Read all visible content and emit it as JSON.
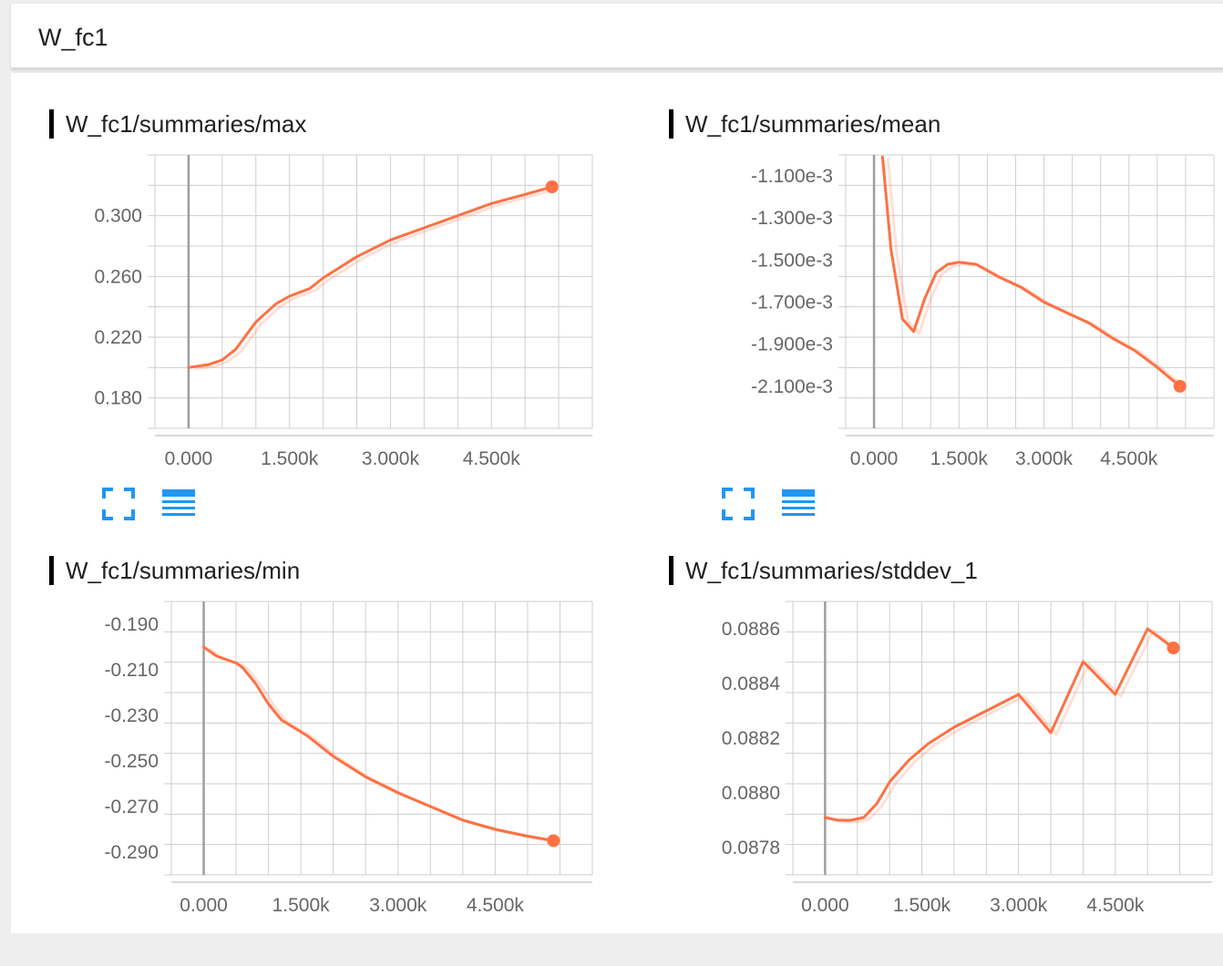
{
  "section": {
    "title": "W_fc1"
  },
  "accent_color": "#ff7043",
  "button_color": "#2196f3",
  "icons": {
    "expand": "fullscreen-icon",
    "data": "list-lines-icon"
  },
  "chart_data": [
    {
      "type": "line",
      "title": "W_fc1/summaries/max",
      "x_ticks": [
        "0.000",
        "1.500k",
        "3.000k",
        "4.500k"
      ],
      "x_tick_values": [
        0,
        1500,
        3000,
        4500
      ],
      "y_ticks": [
        "0.180",
        "0.220",
        "0.260",
        "0.300"
      ],
      "y_tick_values": [
        0.18,
        0.22,
        0.26,
        0.3
      ],
      "xlim": [
        -500,
        6000
      ],
      "ylim": [
        0.16,
        0.34
      ],
      "grid": true,
      "series": [
        {
          "x": [
            0,
            300,
            500,
            700,
            1000,
            1300,
            1500,
            1800,
            2000,
            2500,
            3000,
            3500,
            4000,
            4500,
            5000,
            5400
          ],
          "y": [
            0.2,
            0.202,
            0.205,
            0.212,
            0.23,
            0.242,
            0.247,
            0.252,
            0.259,
            0.273,
            0.284,
            0.292,
            0.3,
            0.308,
            0.314,
            0.319
          ]
        }
      ]
    },
    {
      "type": "line",
      "title": "W_fc1/summaries/mean",
      "x_ticks": [
        "0.000",
        "1.500k",
        "3.000k",
        "4.500k"
      ],
      "x_tick_values": [
        0,
        1500,
        3000,
        4500
      ],
      "y_ticks": [
        "-1.100e-3",
        "-1.300e-3",
        "-1.500e-3",
        "-1.700e-3",
        "-1.900e-3",
        "-2.100e-3"
      ],
      "y_tick_values": [
        -0.0011,
        -0.0013,
        -0.0015,
        -0.0017,
        -0.0019,
        -0.0021
      ],
      "xlim": [
        -500,
        6000
      ],
      "ylim": [
        -0.0023,
        -0.001
      ],
      "grid": true,
      "series": [
        {
          "x": [
            150,
            300,
            500,
            700,
            900,
            1100,
            1300,
            1500,
            1800,
            2200,
            2600,
            3000,
            3400,
            3800,
            4200,
            4600,
            5000,
            5400
          ],
          "y": [
            -0.00101,
            -0.00145,
            -0.00178,
            -0.00184,
            -0.00168,
            -0.00156,
            -0.00152,
            -0.00151,
            -0.00152,
            -0.00158,
            -0.00163,
            -0.0017,
            -0.00175,
            -0.0018,
            -0.00187,
            -0.00193,
            -0.00201,
            -0.0021
          ]
        }
      ]
    },
    {
      "type": "line",
      "title": "W_fc1/summaries/min",
      "x_ticks": [
        "0.000",
        "1.500k",
        "3.000k",
        "4.500k"
      ],
      "x_tick_values": [
        0,
        1500,
        3000,
        4500
      ],
      "y_ticks": [
        "-0.190",
        "-0.210",
        "-0.230",
        "-0.250",
        "-0.270",
        "-0.290"
      ],
      "y_tick_values": [
        -0.19,
        -0.21,
        -0.23,
        -0.25,
        -0.27,
        -0.29
      ],
      "xlim": [
        -500,
        6000
      ],
      "ylim": [
        -0.3,
        -0.18
      ],
      "grid": true,
      "series": [
        {
          "x": [
            0,
            200,
            500,
            600,
            800,
            1000,
            1200,
            1600,
            2000,
            2500,
            3000,
            3500,
            4000,
            4500,
            5000,
            5400
          ],
          "y": [
            -0.2,
            -0.204,
            -0.207,
            -0.209,
            -0.216,
            -0.225,
            -0.232,
            -0.239,
            -0.248,
            -0.257,
            -0.264,
            -0.27,
            -0.276,
            -0.28,
            -0.283,
            -0.285
          ]
        }
      ]
    },
    {
      "type": "line",
      "title": "W_fc1/summaries/stddev_1",
      "x_ticks": [
        "0.000",
        "1.500k",
        "3.000k",
        "4.500k"
      ],
      "x_tick_values": [
        0,
        1500,
        3000,
        4500
      ],
      "y_ticks": [
        "0.0886",
        "0.0884",
        "0.0882",
        "0.0880",
        "0.0878"
      ],
      "y_tick_values": [
        0.0886,
        0.0884,
        0.0882,
        0.088,
        0.0878
      ],
      "xlim": [
        -500,
        6000
      ],
      "ylim": [
        0.0877,
        0.0887
      ],
      "grid": true,
      "series": [
        {
          "x": [
            0,
            200,
            400,
            600,
            800,
            1000,
            1300,
            1600,
            2000,
            2500,
            3000,
            3500,
            4000,
            4500,
            5000,
            5400
          ],
          "y": [
            0.08791,
            0.0879,
            0.0879,
            0.08791,
            0.08796,
            0.08804,
            0.08812,
            0.08818,
            0.08824,
            0.0883,
            0.08836,
            0.08822,
            0.08848,
            0.08836,
            0.0886,
            0.08853
          ]
        }
      ]
    }
  ]
}
